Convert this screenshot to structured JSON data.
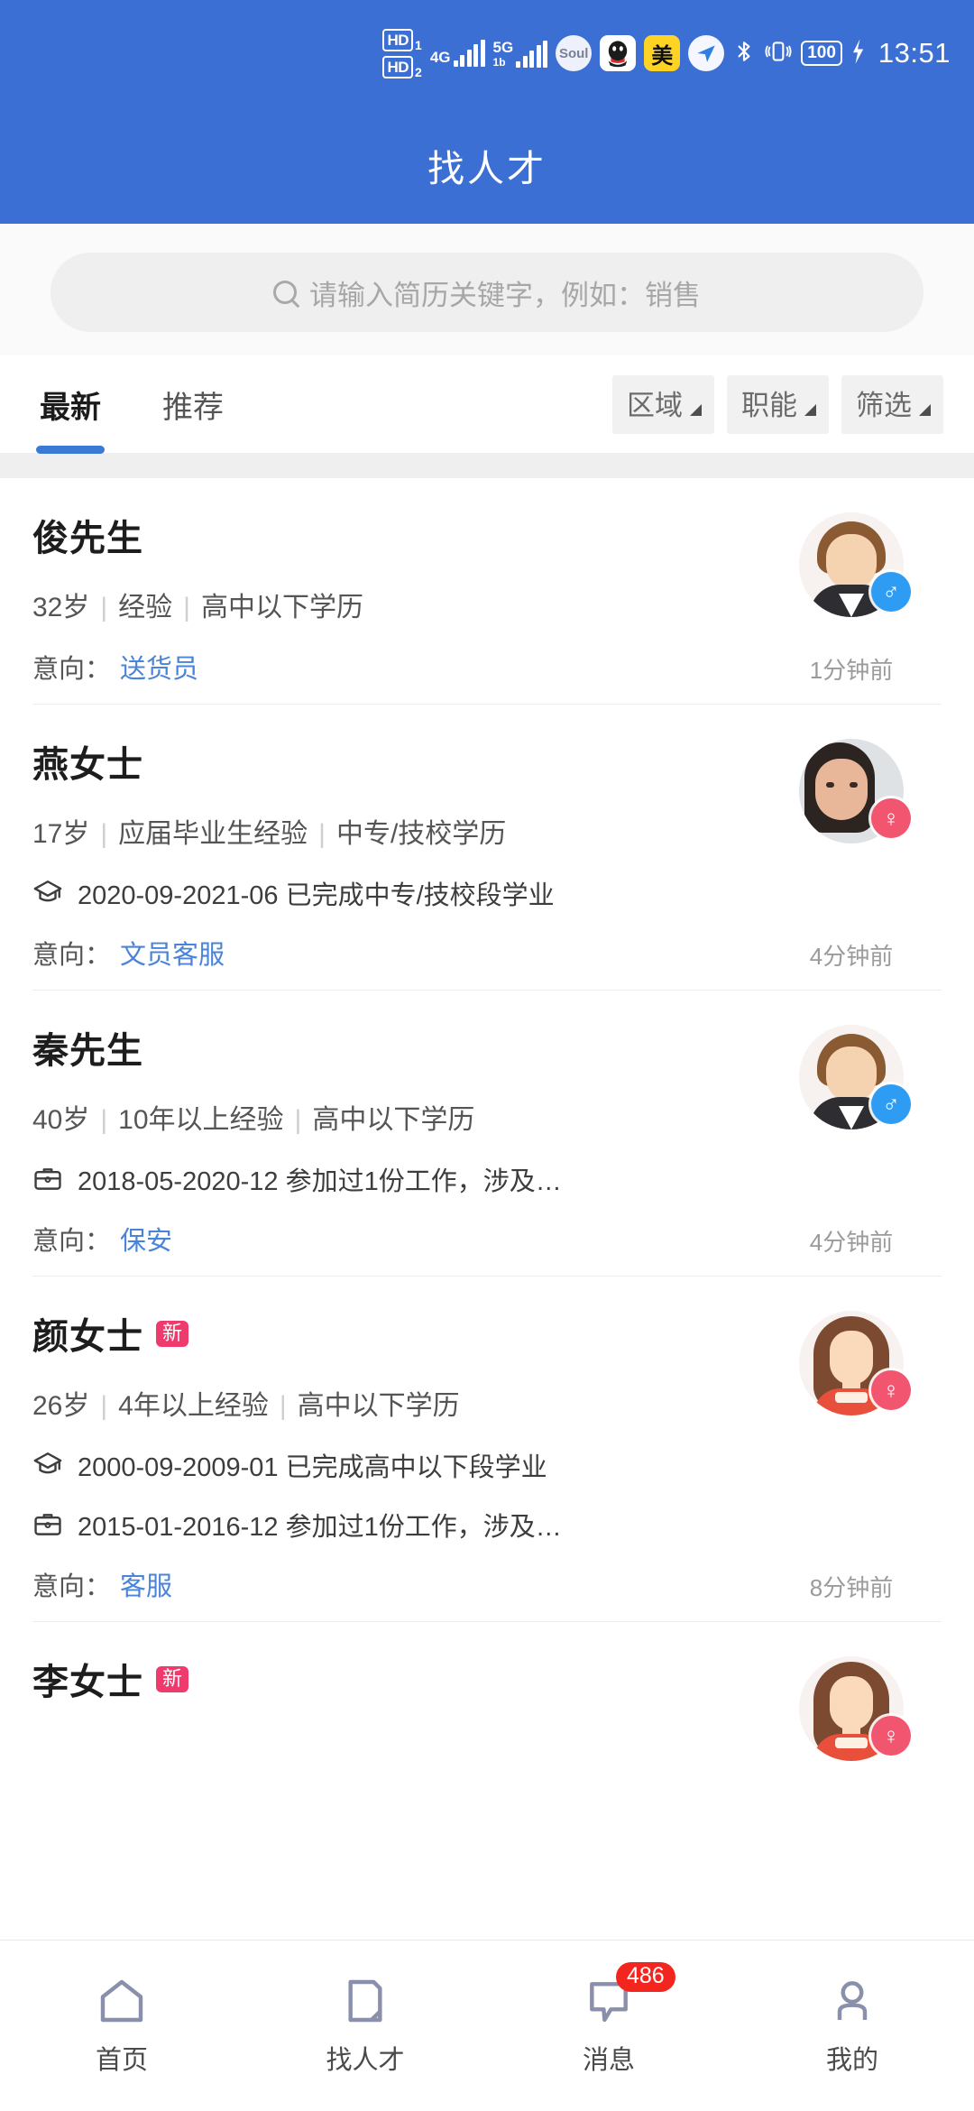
{
  "statusbar": {
    "hd1": "HD",
    "hd1_num": "1",
    "hd2": "HD",
    "hd2_num": "2",
    "net1": "4G",
    "net2": "5G",
    "net2_sub": "1b",
    "apps": [
      "Soul",
      "QQ",
      "美",
      "plane-icon"
    ],
    "soul_label": "Soul",
    "mei_label": "美",
    "bluetooth": "✶",
    "vibrate": "📳",
    "battery": "100",
    "charging": "⚡",
    "time": "13:51"
  },
  "header": {
    "title": "找人才"
  },
  "search": {
    "placeholder": "请输入简历关键字，例如：销售",
    "icon": "search-icon"
  },
  "tabs": [
    {
      "label": "最新",
      "active": true
    },
    {
      "label": "推荐",
      "active": false
    }
  ],
  "filters": [
    {
      "label": "区域"
    },
    {
      "label": "职能"
    },
    {
      "label": "筛选"
    }
  ],
  "colors": {
    "brand_blue": "#3b6fd4",
    "tab_underline": "#3b7ad4",
    "link_blue": "#4a84d8",
    "new_badge": "#ef3a6e",
    "count_badge": "#f3251f",
    "male_badge": "#2f9cf4",
    "female_badge": "#f2556f"
  },
  "candidates": [
    {
      "name": "俊先生",
      "new": false,
      "age": "32岁",
      "experience": "经验",
      "education": "高中以下学历",
      "details": [],
      "intent_label": "意向：",
      "intent_value": "送货员",
      "time_ago": "1分钟前",
      "gender": "male",
      "gender_symbol": "♂",
      "avatar": "male-avatar"
    },
    {
      "name": "燕女士",
      "new": false,
      "age": "17岁",
      "experience": "应届毕业生经验",
      "education": "中专/技校学历",
      "details": [
        {
          "icon": "graduation-cap-icon",
          "text": "2020-09-2021-06 已完成中专/技校段学业"
        }
      ],
      "intent_label": "意向：",
      "intent_value": "文员客服",
      "time_ago": "4分钟前",
      "gender": "female",
      "gender_symbol": "♀",
      "avatar": "photo-avatar"
    },
    {
      "name": "秦先生",
      "new": false,
      "age": "40岁",
      "experience": "10年以上经验",
      "education": "高中以下学历",
      "details": [
        {
          "icon": "briefcase-icon",
          "text": "2018-05-2020-12 参加过1份工作，涉及…"
        }
      ],
      "intent_label": "意向：",
      "intent_value": "保安",
      "time_ago": "4分钟前",
      "gender": "male",
      "gender_symbol": "♂",
      "avatar": "male-avatar"
    },
    {
      "name": "颜女士",
      "new": true,
      "new_label": "新",
      "age": "26岁",
      "experience": "4年以上经验",
      "education": "高中以下学历",
      "details": [
        {
          "icon": "graduation-cap-icon",
          "text": "2000-09-2009-01 已完成高中以下段学业"
        },
        {
          "icon": "briefcase-icon",
          "text": "2015-01-2016-12 参加过1份工作，涉及…"
        }
      ],
      "intent_label": "意向：",
      "intent_value": "客服",
      "time_ago": "8分钟前",
      "gender": "female",
      "gender_symbol": "♀",
      "avatar": "female-avatar"
    },
    {
      "name": "李女士",
      "new": true,
      "new_label": "新",
      "age": "",
      "experience": "",
      "education": "",
      "details": [],
      "intent_label": "",
      "intent_value": "",
      "time_ago": "",
      "gender": "female",
      "gender_symbol": "♀",
      "avatar": "female-avatar"
    }
  ],
  "bottom_nav": [
    {
      "label": "首页",
      "icon": "home-icon",
      "badge": ""
    },
    {
      "label": "找人才",
      "icon": "document-icon",
      "badge": ""
    },
    {
      "label": "消息",
      "icon": "chat-icon",
      "badge": "486"
    },
    {
      "label": "我的",
      "icon": "person-icon",
      "badge": ""
    }
  ]
}
